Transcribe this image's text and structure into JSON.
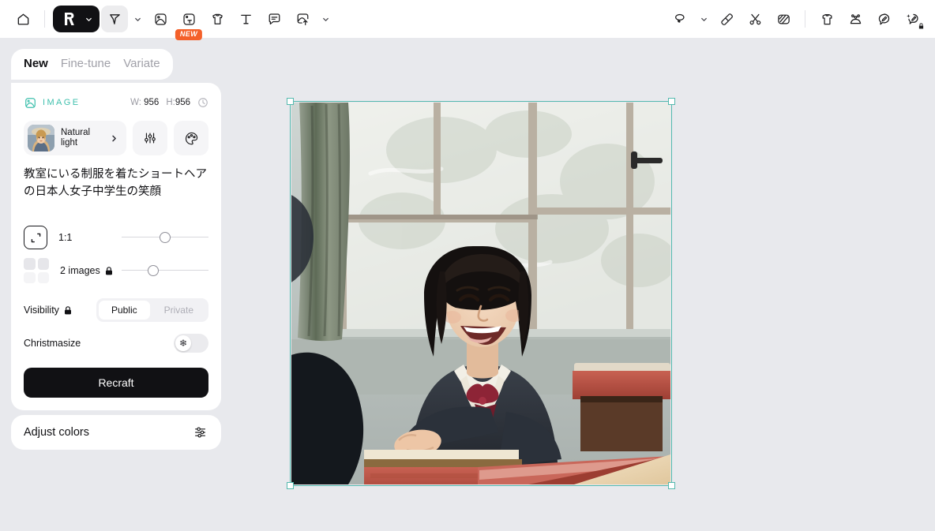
{
  "toolbar": {
    "left_items": [
      {
        "name": "home-icon",
        "label": "Home"
      },
      {
        "name": "recraft-logo-icon",
        "label": "Recraft"
      },
      {
        "name": "select-tool-icon",
        "label": "Select"
      },
      {
        "name": "image-icon",
        "label": "Image"
      },
      {
        "name": "image-text-icon",
        "label": "Image with text"
      },
      {
        "name": "mockup-icon",
        "label": "Mockup"
      },
      {
        "name": "text-icon",
        "label": "Text"
      },
      {
        "name": "comment-icon",
        "label": "Comment"
      },
      {
        "name": "upload-image-icon",
        "label": "Upload"
      }
    ],
    "right_items": [
      {
        "name": "lasso-icon",
        "label": "Lasso"
      },
      {
        "name": "eraser-icon",
        "label": "Eraser"
      },
      {
        "name": "scissors-icon",
        "label": "Cut out"
      },
      {
        "name": "texture-icon",
        "label": "Texture"
      },
      {
        "name": "apparel-icon",
        "label": "Apparel mockup"
      },
      {
        "name": "set-icon",
        "label": "Mockup set"
      },
      {
        "name": "edit-bubble-icon",
        "label": "Edit"
      },
      {
        "name": "magic-edit-icon",
        "label": "Magic edit"
      }
    ],
    "new_badge": "NEW"
  },
  "panel": {
    "tabs": [
      {
        "label": "New",
        "selected": true
      },
      {
        "label": "Fine-tune",
        "selected": false
      },
      {
        "label": "Variate",
        "selected": false
      }
    ],
    "image_section": {
      "label": "IMAGE",
      "width_key": "W:",
      "width_value": "956",
      "height_key": "H:",
      "height_value": "956"
    },
    "style": {
      "name": "Natural light"
    },
    "prompt": "教室にいる制服を着たショートヘアの日本人女子中学生の笑顔",
    "aspect_ratio": {
      "label": "1:1",
      "slider_percent": 47
    },
    "image_count": {
      "label": "2 images",
      "slider_percent": 33,
      "locked": true
    },
    "visibility": {
      "label": "Visibility",
      "locked": true,
      "options": [
        {
          "label": "Public",
          "selected": true
        },
        {
          "label": "Private",
          "selected": false
        }
      ]
    },
    "christmasize": {
      "label": "Christmasize",
      "enabled": false,
      "glyph": "❄"
    },
    "generate_button": "Recraft",
    "adjust_colors": "Adjust colors"
  },
  "colors": {
    "accent_teal": "#3fc0ad",
    "selection_teal": "#54b9ae",
    "badge_orange": "#f4602a",
    "background": "#e8e9ed",
    "panel": "#ffffff",
    "button_dark": "#111114"
  }
}
